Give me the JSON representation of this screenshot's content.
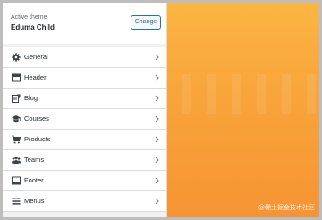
{
  "theme": {
    "active_label": "Active theme",
    "name": "Eduma Child",
    "change_label": "Change"
  },
  "menu": {
    "items": [
      {
        "label": "General",
        "icon": "gear-icon"
      },
      {
        "label": "Header",
        "icon": "header-icon"
      },
      {
        "label": "Blog",
        "icon": "blog-icon"
      },
      {
        "label": "Courses",
        "icon": "graduation-cap-icon"
      },
      {
        "label": "Products",
        "icon": "cart-icon"
      },
      {
        "label": "Teams",
        "icon": "team-icon"
      },
      {
        "label": "Footer",
        "icon": "footer-icon"
      },
      {
        "label": "Menus",
        "icon": "menu-icon"
      }
    ]
  },
  "watermark": "@稀土掘金技术社区",
  "colors": {
    "accent": "#2271b1",
    "preview_top": "#fbb542",
    "preview_bottom": "#f69433"
  }
}
